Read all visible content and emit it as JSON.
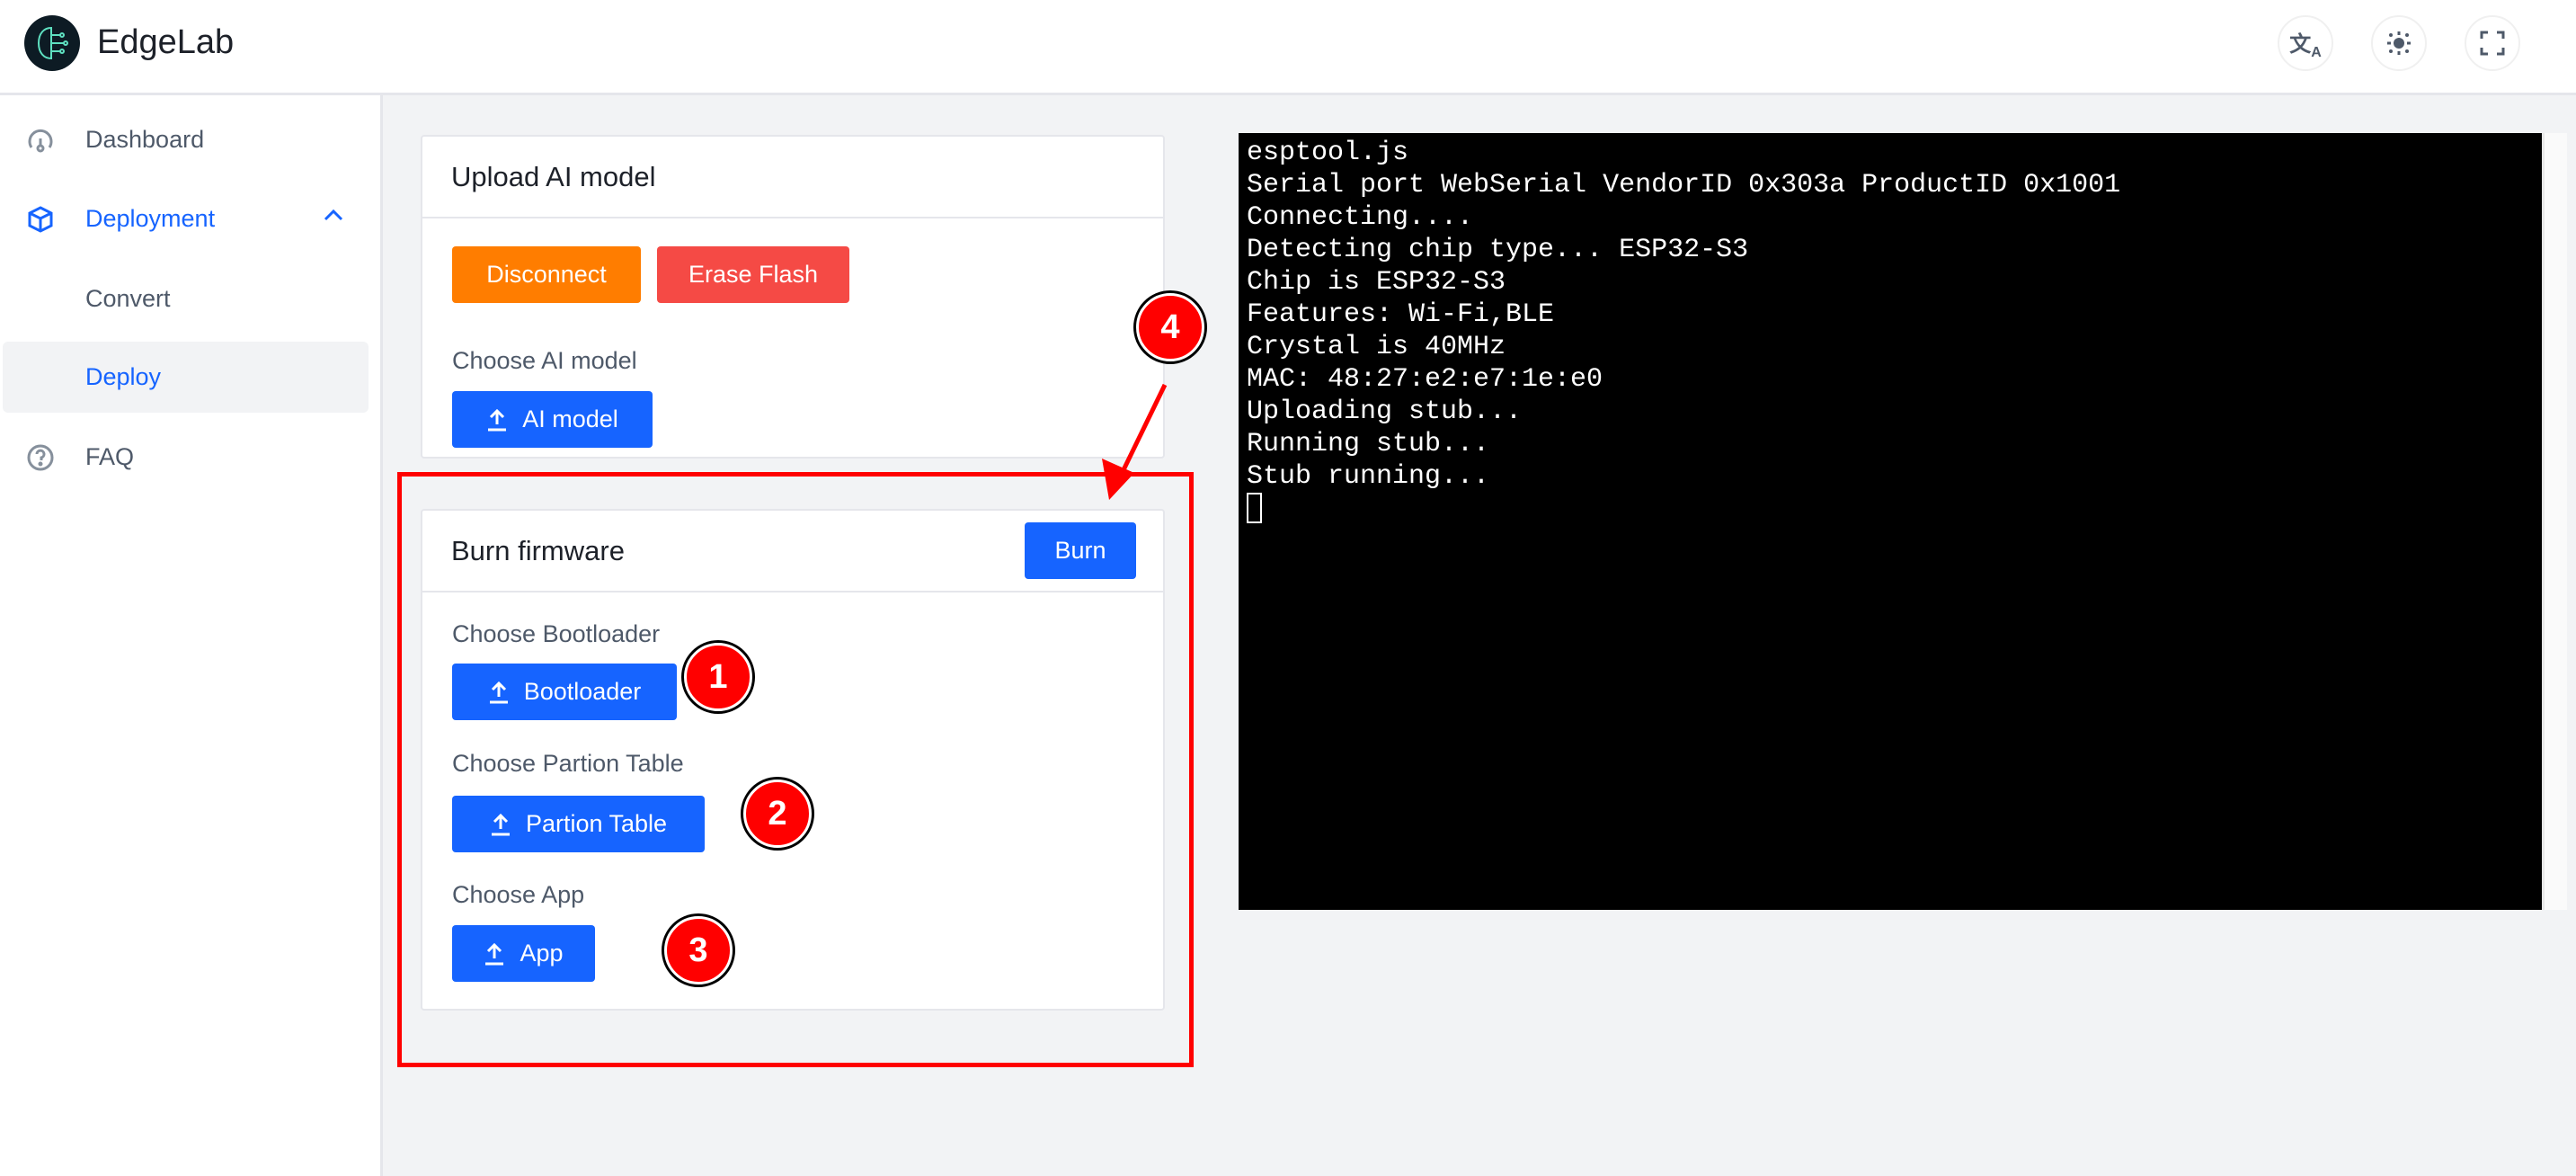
{
  "app": {
    "title": "EdgeLab"
  },
  "header": {
    "icons": [
      "translate-icon",
      "theme-sun-icon",
      "fullscreen-icon"
    ]
  },
  "sidebar": {
    "items": [
      {
        "label": "Dashboard",
        "icon": "dashboard-icon"
      },
      {
        "label": "Deployment",
        "icon": "cube-icon",
        "expanded": true
      },
      {
        "label": "Convert"
      },
      {
        "label": "Deploy",
        "selected": true
      },
      {
        "label": "FAQ",
        "icon": "question-icon"
      }
    ]
  },
  "upload_card": {
    "title": "Upload AI model",
    "disconnect": "Disconnect",
    "erase": "Erase Flash",
    "choose_label": "Choose AI model",
    "model_button": "AI model"
  },
  "burn_card": {
    "title": "Burn firmware",
    "burn": "Burn",
    "bootloader_label": "Choose Bootloader",
    "bootloader_button": "Bootloader",
    "partition_label": "Choose Partion Table",
    "partition_button": "Partion Table",
    "app_label": "Choose App",
    "app_button": "App"
  },
  "annotations": [
    "1",
    "2",
    "3",
    "4"
  ],
  "terminal": {
    "lines": [
      "esptool.js",
      "Serial port WebSerial VendorID 0x303a ProductID 0x1001",
      "Connecting....",
      "Detecting chip type... ESP32-S3",
      "Chip is ESP32-S3",
      "Features: Wi-Fi,BLE",
      "Crystal is 40MHz",
      "MAC: 48:27:e2:e7:1e:e0",
      "Uploading stub...",
      "Running stub...",
      "Stub running..."
    ]
  },
  "colors": {
    "primary": "#1664ff",
    "warning": "#ff7d00",
    "danger": "#f54a45",
    "annotation": "#ff0000"
  }
}
